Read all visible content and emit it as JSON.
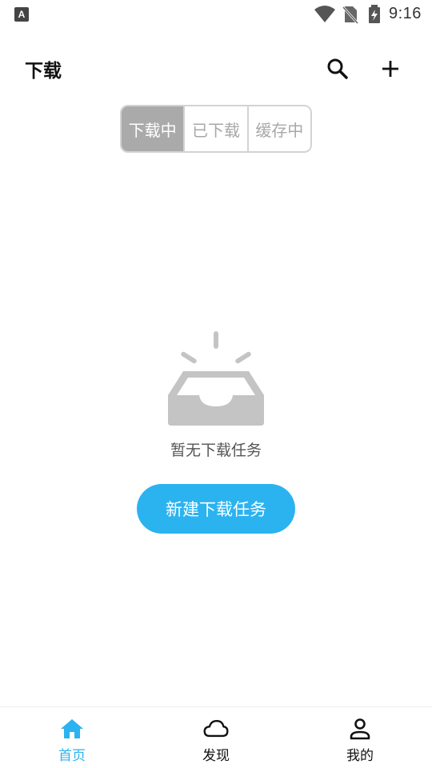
{
  "status_bar": {
    "time": "9:16",
    "left_icon_letter": "A",
    "icons": [
      "text-input-icon",
      "wifi-icon",
      "no-sim-icon",
      "battery-charging-icon"
    ]
  },
  "header": {
    "title": "下载",
    "icons": [
      "search-icon",
      "plus-icon"
    ]
  },
  "tabs": [
    {
      "label": "下载中",
      "active": true
    },
    {
      "label": "已下载",
      "active": false
    },
    {
      "label": "缓存中",
      "active": false
    }
  ],
  "empty_state": {
    "icon": "empty-inbox-icon",
    "message": "暂无下载任务",
    "button_label": "新建下载任务"
  },
  "bottom_nav": [
    {
      "label": "首页",
      "icon": "home-icon",
      "active": true
    },
    {
      "label": "发现",
      "icon": "cloud-icon",
      "active": false
    },
    {
      "label": "我的",
      "icon": "user-icon",
      "active": false
    }
  ],
  "colors": {
    "accent": "#2bb3f0",
    "tab_active_bg": "#aaaaaa",
    "tab_border": "#d3d3d3",
    "empty_icon": "#c4c4c4"
  }
}
